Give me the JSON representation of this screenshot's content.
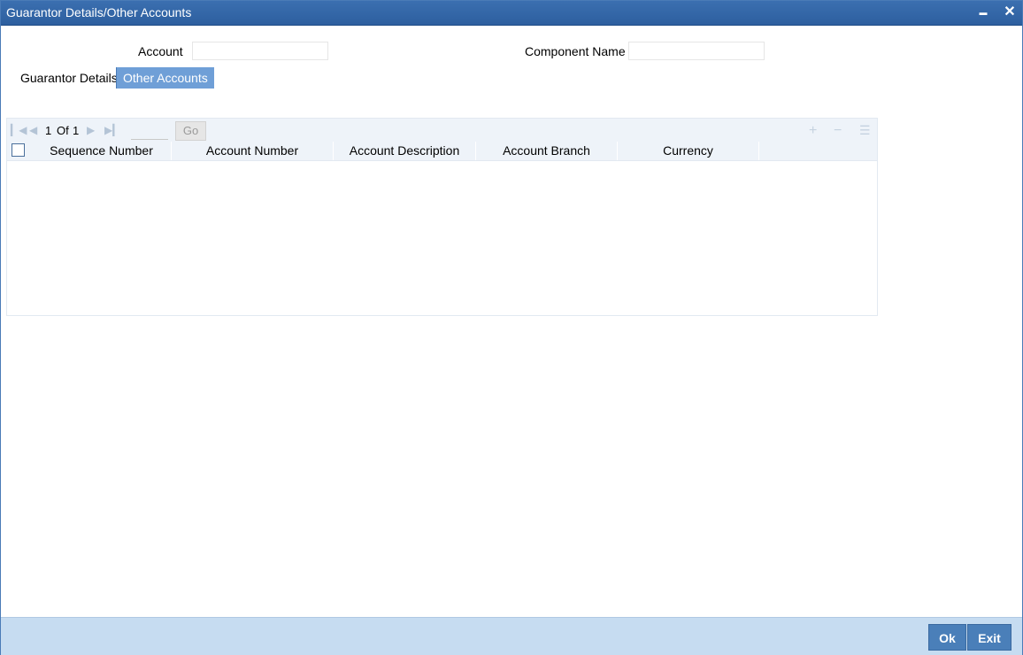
{
  "window": {
    "title": "Guarantor Details/Other Accounts",
    "minimize_glyph": "▬",
    "close_glyph": "✕"
  },
  "fields": {
    "account_label": "Account",
    "account_value": "",
    "component_label": "Component Name",
    "component_value": ""
  },
  "tabs": [
    {
      "label": "Guarantor Details",
      "active": false
    },
    {
      "label": "Other Accounts",
      "active": true
    }
  ],
  "grid": {
    "pagination": {
      "current": "1",
      "of_label": "Of",
      "total": "1",
      "go_label": "Go",
      "page_input": ""
    },
    "columns": [
      "Sequence Number",
      "Account Number",
      "Account Description",
      "Account Branch",
      "Currency"
    ],
    "rows": []
  },
  "footer": {
    "ok_label": "Ok",
    "exit_label": "Exit"
  },
  "colors": {
    "title_bar": "#2d5f9f",
    "active_tab": "#6f9fd7",
    "footer": "#c6dcf1",
    "button": "#4a7fb9"
  }
}
